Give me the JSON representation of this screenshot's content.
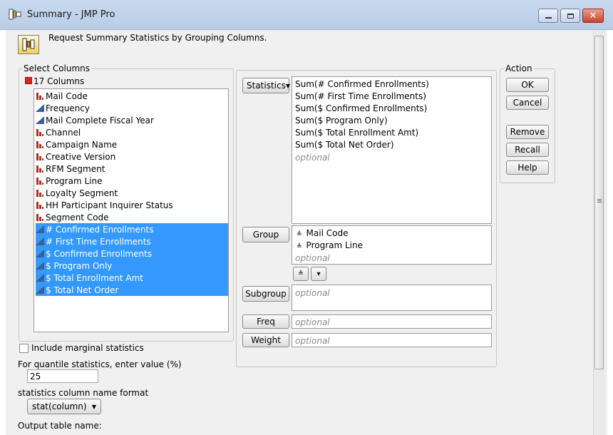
{
  "window": {
    "title": "Summary - JMP Pro",
    "minimize_icon": "minimize-icon",
    "maximize_icon": "maximize-icon",
    "close_icon": "close-icon"
  },
  "header": {
    "text": "Request Summary Statistics by Grouping Columns."
  },
  "select_columns": {
    "label": "Select Columns",
    "count_label": "17 Columns",
    "items": [
      {
        "label": "Mail Code",
        "type": "nominal",
        "selected": false
      },
      {
        "label": "Frequency",
        "type": "continuous",
        "selected": false
      },
      {
        "label": "Mail Complete Fiscal Year",
        "type": "continuous",
        "selected": false
      },
      {
        "label": "Channel",
        "type": "nominal",
        "selected": false
      },
      {
        "label": "Campaign Name",
        "type": "nominal",
        "selected": false
      },
      {
        "label": "Creative Version",
        "type": "nominal",
        "selected": false
      },
      {
        "label": "RFM Segment",
        "type": "nominal",
        "selected": false
      },
      {
        "label": "Program Line",
        "type": "nominal",
        "selected": false
      },
      {
        "label": "Loyalty Segment",
        "type": "nominal",
        "selected": false
      },
      {
        "label": "HH Participant Inquirer Status",
        "type": "nominal",
        "selected": false
      },
      {
        "label": "Segment Code",
        "type": "nominal",
        "selected": false
      },
      {
        "label": "# Confirmed Enrollments",
        "type": "continuous",
        "selected": true
      },
      {
        "label": "# First Time Enrollments",
        "type": "continuous",
        "selected": true
      },
      {
        "label": "$ Confirmed Enrollments",
        "type": "continuous",
        "selected": true
      },
      {
        "label": "$ Program Only",
        "type": "continuous",
        "selected": true
      },
      {
        "label": "$ Total Enrollment Amt",
        "type": "continuous",
        "selected": true
      },
      {
        "label": "$ Total Net Order",
        "type": "continuous",
        "selected": true
      }
    ]
  },
  "options": {
    "include_marginal_label": "Include marginal statistics",
    "quantile_label": "For quantile statistics, enter value (%)",
    "quantile_value": "25",
    "name_format_label": "statistics column name format",
    "name_format_value": "stat(column)",
    "output_table_label": "Output table name:"
  },
  "roles": {
    "statistics_button": "Statistics",
    "statistics_items": [
      "Sum(# Confirmed Enrollments)",
      "Sum(# First Time Enrollments)",
      "Sum($ Confirmed Enrollments)",
      "Sum($ Program Only)",
      "Sum($ Total Enrollment Amt)",
      "Sum($ Total Net Order)"
    ],
    "optional": "optional",
    "group_button": "Group",
    "group_items": [
      "Mail Code",
      "Program Line"
    ],
    "subgroup_button": "Subgroup",
    "freq_button": "Freq",
    "weight_button": "Weight",
    "order_up_icon": "sort-ascending-icon",
    "order_down_icon": "sort-descending-icon"
  },
  "action": {
    "label": "Action",
    "ok": "OK",
    "cancel": "Cancel",
    "remove": "Remove",
    "recall": "Recall",
    "help": "Help"
  },
  "colors": {
    "selection": "#3399ff",
    "nominal_icon": "#b42c1f",
    "continuous_icon": "#3b5f9a"
  }
}
